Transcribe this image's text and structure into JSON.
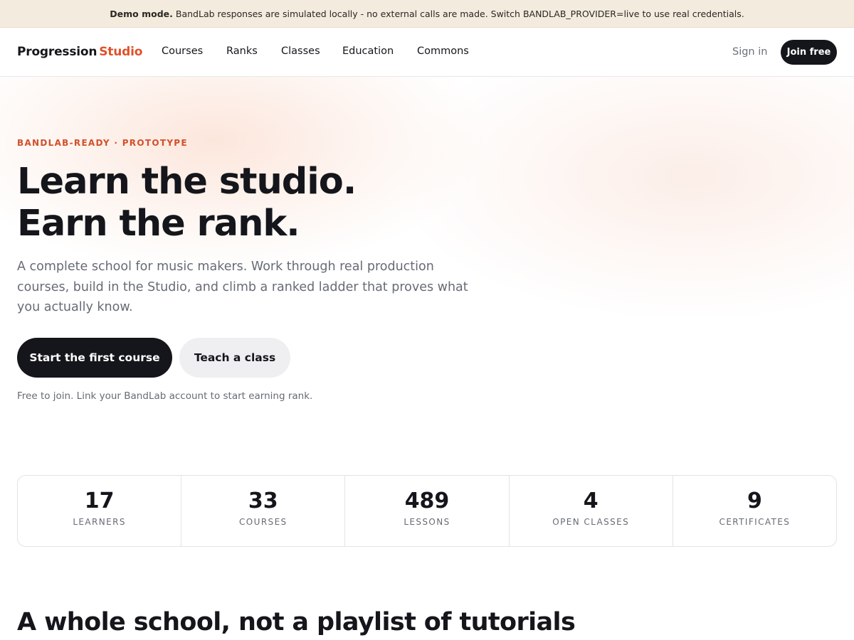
{
  "banner": {
    "strong": "Demo mode.",
    "text": "BandLab responses are simulated locally - no external calls are made. Switch BANDLAB_PROVIDER=live to use real credentials."
  },
  "header": {
    "brand_main": "Progression",
    "brand_accent": "Studio",
    "nav": [
      "Courses",
      "Ranks",
      "Classes",
      "Education",
      "Commons"
    ],
    "signin": "Sign in",
    "join": "Join free"
  },
  "hero": {
    "eyebrow": "BANDLAB-READY · PROTOTYPE",
    "title_line1": "Learn the studio.",
    "title_line2": "Earn the rank.",
    "description": "A complete school for music makers. Work through real production courses, build in the Studio, and climb a ranked ladder that proves what you actually know.",
    "primary_cta": "Start the first course",
    "secondary_cta": "Teach a class",
    "note": "Free to join. Link your BandLab account to start earning rank."
  },
  "stats": [
    {
      "value": "17",
      "label": "LEARNERS"
    },
    {
      "value": "33",
      "label": "COURSES"
    },
    {
      "value": "489",
      "label": "LESSONS"
    },
    {
      "value": "4",
      "label": "OPEN CLASSES"
    },
    {
      "value": "9",
      "label": "CERTIFICATES"
    }
  ],
  "section": {
    "title": "A whole school, not a playlist of tutorials"
  },
  "colors": {
    "accent": "#e0512b",
    "ink": "#15161b",
    "banner_bg": "#f4ebdf",
    "muted": "#666b75"
  }
}
